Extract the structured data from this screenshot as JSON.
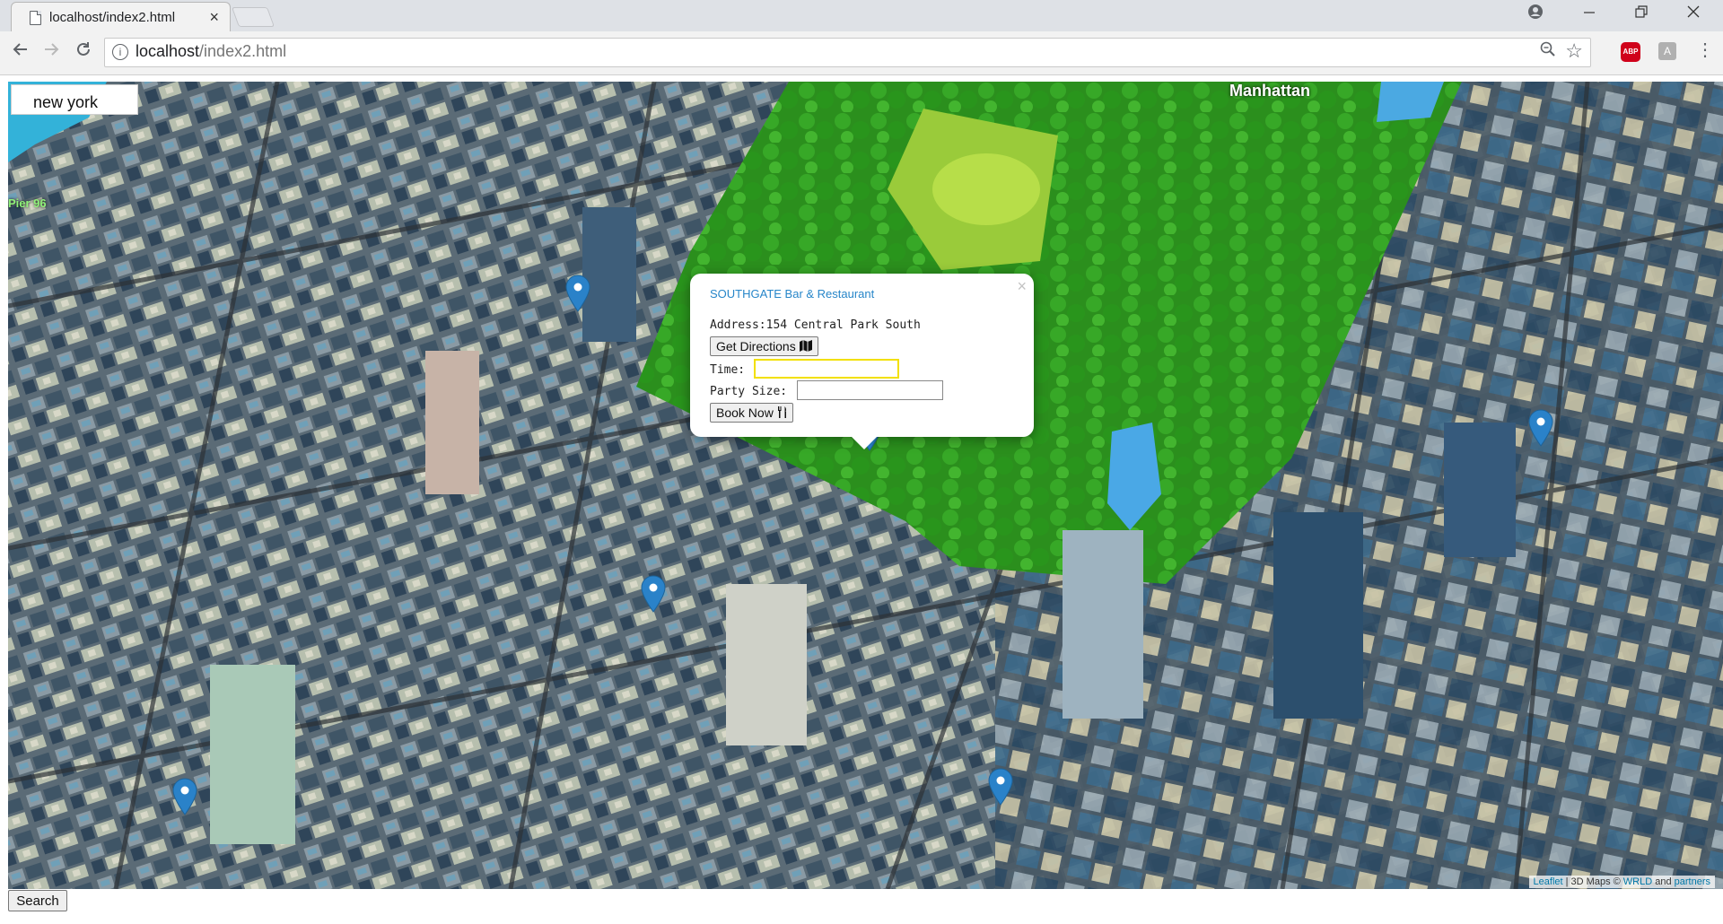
{
  "browser": {
    "tab_title": "localhost/index2.html",
    "tab_close": "×",
    "url_host": "localhost",
    "url_path": "/index2.html",
    "abp_label": "ABP",
    "ext_label": "A",
    "back_icon": "arrow-left",
    "forward_icon": "arrow-right",
    "reload_icon": "reload"
  },
  "map": {
    "search_value": "new york",
    "labels": {
      "manhattan": "Manhattan",
      "pier": "Pier 96"
    },
    "colors": {
      "park": "#2e9b1f",
      "lawn": "#a9d73a",
      "water": "#4aa8e6",
      "pin": "#2a82c9"
    }
  },
  "popup": {
    "title": "SOUTHGATE Bar & Restaurant",
    "address_label": "Address:",
    "address_value": "154 Central Park South",
    "directions_button": "Get Directions",
    "time_label": "Time:",
    "time_value": "",
    "party_label": "Party Size:",
    "party_value": "",
    "book_button": "Book Now",
    "close": "×"
  },
  "attribution": {
    "leaflet": "Leaflet",
    "sep": " | 3D Maps © ",
    "wrld": "WRLD",
    "and": " and ",
    "partners": "partners"
  },
  "search_button": "Search"
}
